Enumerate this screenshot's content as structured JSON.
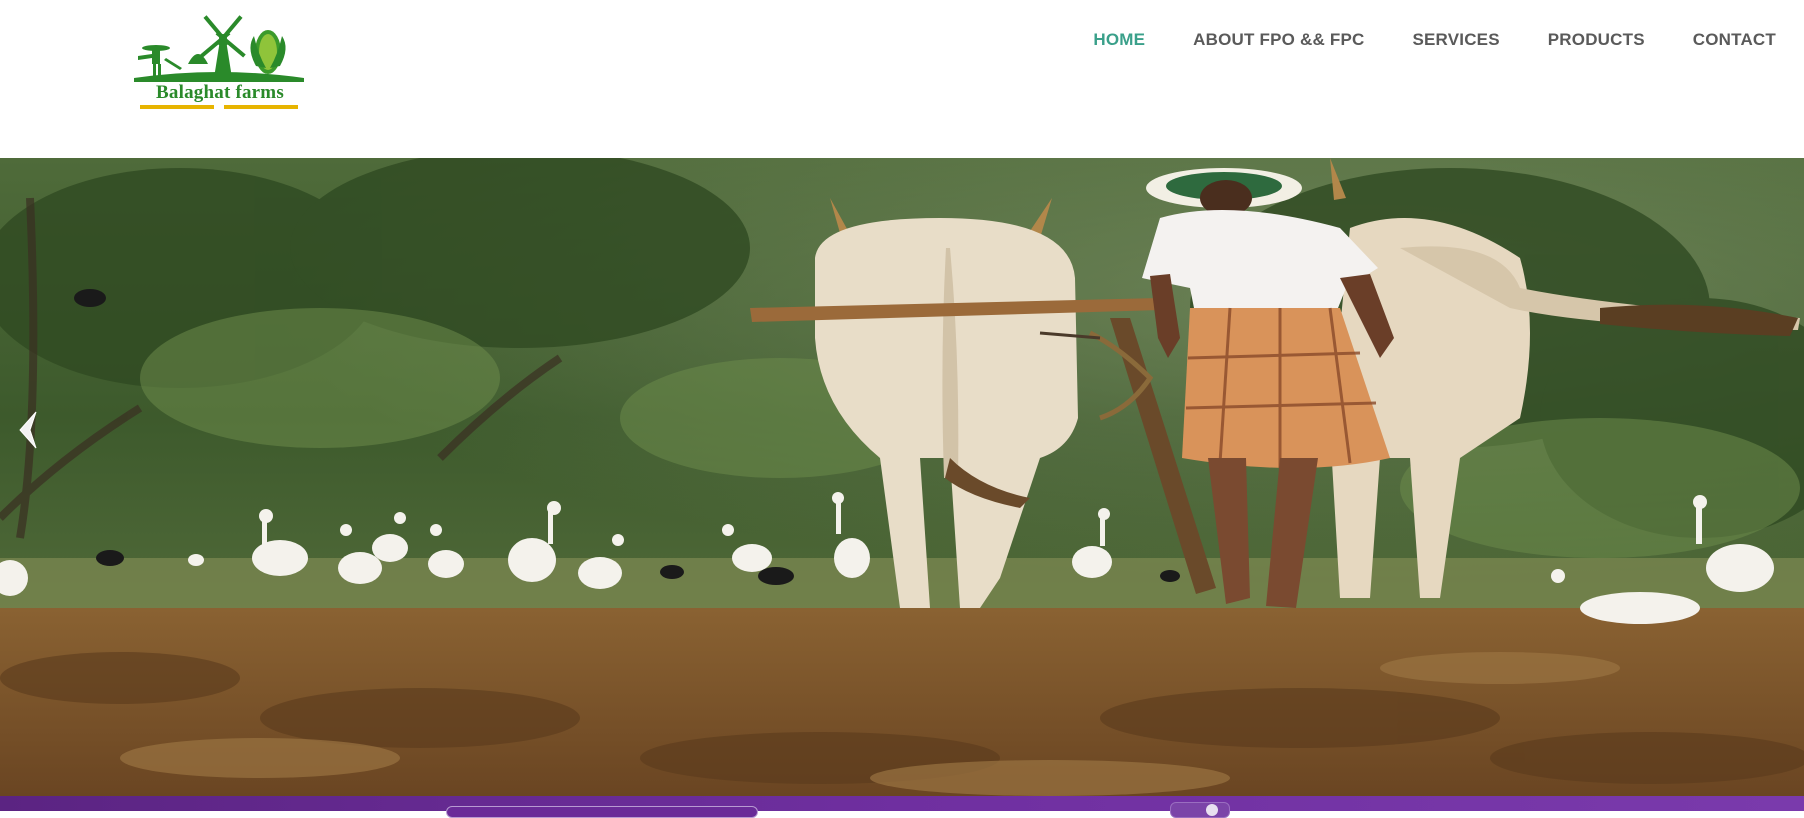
{
  "logo": {
    "brand_text": "Balaghat farms",
    "icons": [
      "farmer-icon",
      "windmill-icon",
      "corn-icon"
    ],
    "colors": {
      "green": "#2a8a2a",
      "yellow": "#e7b400"
    }
  },
  "nav": {
    "items": [
      {
        "label": "HOME",
        "active": true
      },
      {
        "label": "ABOUT FPO && FPC",
        "active": false
      },
      {
        "label": "SERVICES",
        "active": false
      },
      {
        "label": "PRODUCTS",
        "active": false
      },
      {
        "label": "CONTACT",
        "active": false
      }
    ],
    "colors": {
      "active": "#3aa08a",
      "default": "#5a5a5a"
    }
  },
  "hero": {
    "alt_subject": "farmer ploughing with oxen and egrets",
    "prev_arrow_icon": "chevron-left-icon"
  },
  "bottom_band": {
    "color": "#6f2fa0"
  }
}
